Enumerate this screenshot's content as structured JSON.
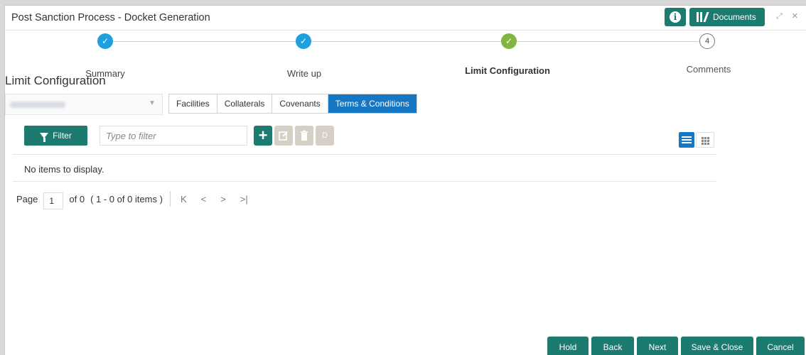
{
  "window": {
    "title": "Post Sanction Process - Docket Generation"
  },
  "header": {
    "documents_label": "Documents",
    "info_icon": "info-icon",
    "documents_icon": "library-icon"
  },
  "stepper": {
    "steps": [
      {
        "label": "Summary",
        "state": "done",
        "color": "#1aa1de"
      },
      {
        "label": "Write up",
        "state": "done",
        "color": "#1aa1de"
      },
      {
        "label": "Limit Configuration",
        "state": "current",
        "color": "#82b541"
      },
      {
        "label": "Comments",
        "state": "pending",
        "number": "4"
      }
    ]
  },
  "section": {
    "title": "Limit Configuration"
  },
  "tabs": [
    {
      "label": "Facilities",
      "active": false
    },
    {
      "label": "Collaterals",
      "active": false
    },
    {
      "label": "Covenants",
      "active": false
    },
    {
      "label": "Terms & Conditions",
      "active": true
    }
  ],
  "toolbar": {
    "filter_label": "Filter",
    "filter_placeholder": "Type to filter",
    "add_icon": "plus-icon",
    "edit_icon": "edit-icon",
    "delete_icon": "trash-icon",
    "d_label": "D"
  },
  "table": {
    "empty_message": "No items to display."
  },
  "pager": {
    "page_label": "Page",
    "page_value": "1",
    "of_label": "of 0",
    "range_label": "( 1 - 0 of 0 items )",
    "first": "K",
    "prev": "<",
    "next": ">",
    "last": ">|"
  },
  "footer": {
    "hold": "Hold",
    "back": "Back",
    "next": "Next",
    "save_close": "Save & Close",
    "cancel": "Cancel"
  },
  "colors": {
    "primary": "#1d7a6e",
    "accent_blue": "#1678c2",
    "step_blue": "#1aa1de",
    "step_green": "#82b541"
  }
}
